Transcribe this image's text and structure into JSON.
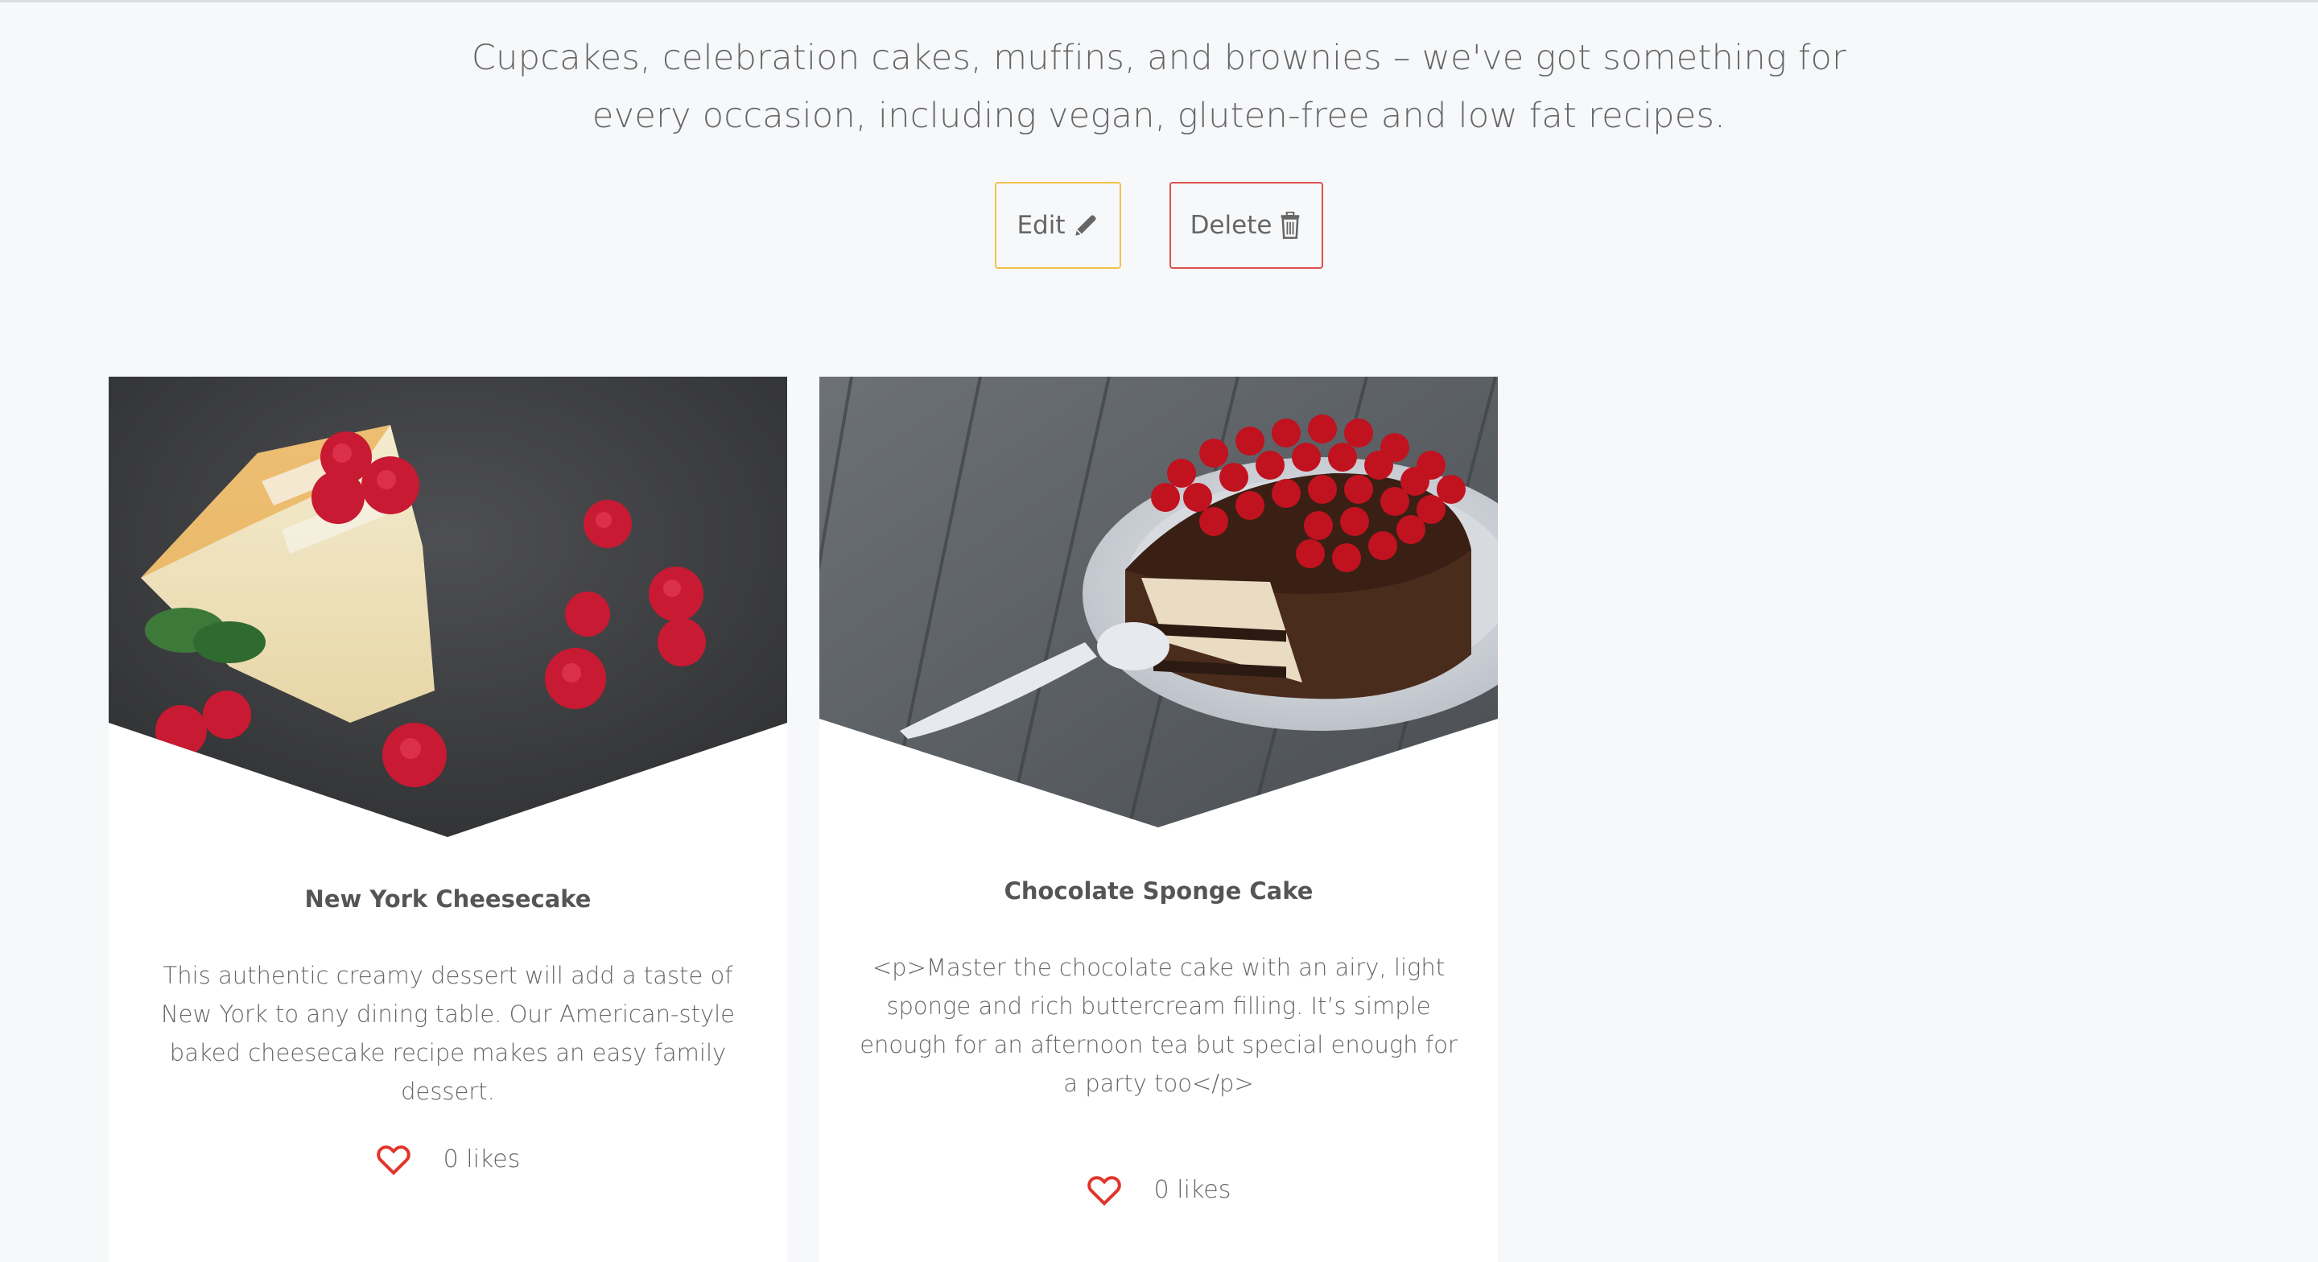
{
  "intro": {
    "line1": "Cupcakes, celebration cakes, muffins, and brownies – we've got something for",
    "line2": "every occasion, including vegan, gluten-free and low fat recipes."
  },
  "actions": {
    "edit_label": "Edit",
    "delete_label": "Delete",
    "edit_color": "#f2c14e",
    "delete_color": "#d9534f"
  },
  "recipes": [
    {
      "title": "New York Cheesecake",
      "description": "This authentic creamy dessert will add a taste of New York to any dining table. Our American-style baked cheesecake recipe makes an easy family dessert.",
      "likes": "0 likes",
      "image_icon": "cheesecake-photo"
    },
    {
      "title": "Chocolate Sponge Cake",
      "description": "<p>Master the chocolate cake with an airy, light sponge and rich buttercream filling. It’s simple enough for an afternoon tea but special enough for a party too</p>",
      "likes": "0 likes",
      "image_icon": "chocolate-cake-photo"
    }
  ],
  "colors": {
    "heart": "#e0352b",
    "background": "#f7f8fa"
  }
}
